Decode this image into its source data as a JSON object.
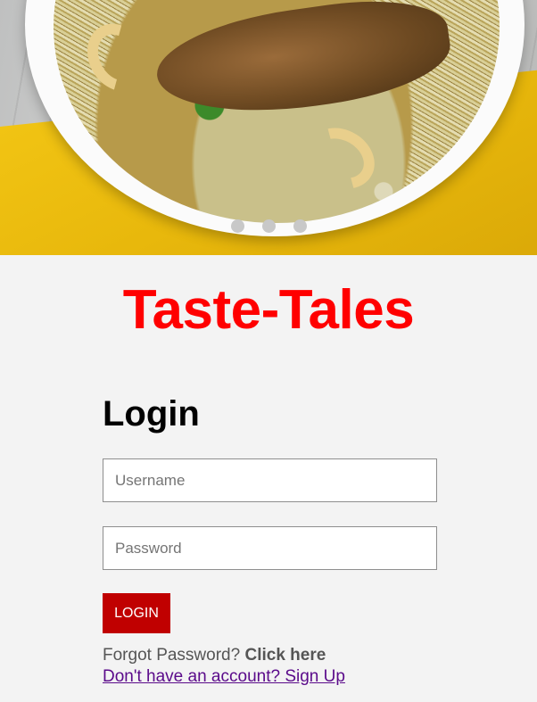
{
  "hero": {
    "slide_count": 3,
    "active_slide": 1
  },
  "brand": {
    "title": "Taste-Tales",
    "color": "#ff0000"
  },
  "login": {
    "heading": "Login",
    "username": {
      "placeholder": "Username",
      "value": ""
    },
    "password": {
      "placeholder": "Password",
      "value": ""
    },
    "button_label": "LOGIN",
    "button_color": "#c00000",
    "forgot_prefix": "Forgot Password?",
    "forgot_link": "Click here",
    "signup_link": "Don't have an account? Sign Up"
  }
}
